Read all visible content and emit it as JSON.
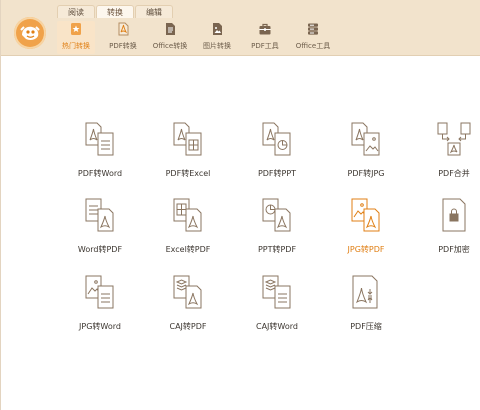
{
  "tabs": [
    {
      "label": "阅读"
    },
    {
      "label": "转换"
    },
    {
      "label": "编辑"
    }
  ],
  "toolbar": [
    {
      "label": "热门转换",
      "icon": "star-doc-icon",
      "active": true
    },
    {
      "label": "PDF转换",
      "icon": "pdf-doc-icon"
    },
    {
      "label": "Office转换",
      "icon": "office-doc-icon"
    },
    {
      "label": "图片转换",
      "icon": "image-doc-icon"
    },
    {
      "label": "PDF工具",
      "icon": "toolbox-icon"
    },
    {
      "label": "Office工具",
      "icon": "database-icon"
    }
  ],
  "grid": {
    "rows": [
      [
        {
          "label": "PDF转Word",
          "icon": "pdf-to-word-icon"
        },
        {
          "label": "PDF转Excel",
          "icon": "pdf-to-excel-icon"
        },
        {
          "label": "PDF转PPT",
          "icon": "pdf-to-ppt-icon"
        },
        {
          "label": "PDF转JPG",
          "icon": "pdf-to-jpg-icon"
        },
        {
          "label": "PDF合并",
          "icon": "pdf-merge-icon"
        }
      ],
      [
        {
          "label": "Word转PDF",
          "icon": "word-to-pdf-icon"
        },
        {
          "label": "Excel转PDF",
          "icon": "excel-to-pdf-icon"
        },
        {
          "label": "PPT转PDF",
          "icon": "ppt-to-pdf-icon"
        },
        {
          "label": "JPG转PDF",
          "icon": "jpg-to-pdf-icon",
          "highlight": true
        },
        {
          "label": "PDF加密",
          "icon": "pdf-encrypt-icon"
        }
      ],
      [
        {
          "label": "JPG转Word",
          "icon": "jpg-to-word-icon"
        },
        {
          "label": "CAJ转PDF",
          "icon": "caj-to-pdf-icon"
        },
        {
          "label": "CAJ转Word",
          "icon": "caj-to-word-icon"
        },
        {
          "label": "PDF压缩",
          "icon": "pdf-compress-icon"
        }
      ]
    ]
  },
  "colors": {
    "accent": "#e07f14",
    "ribbon": "#f2e3cc",
    "icon_stroke": "#8a7560"
  }
}
